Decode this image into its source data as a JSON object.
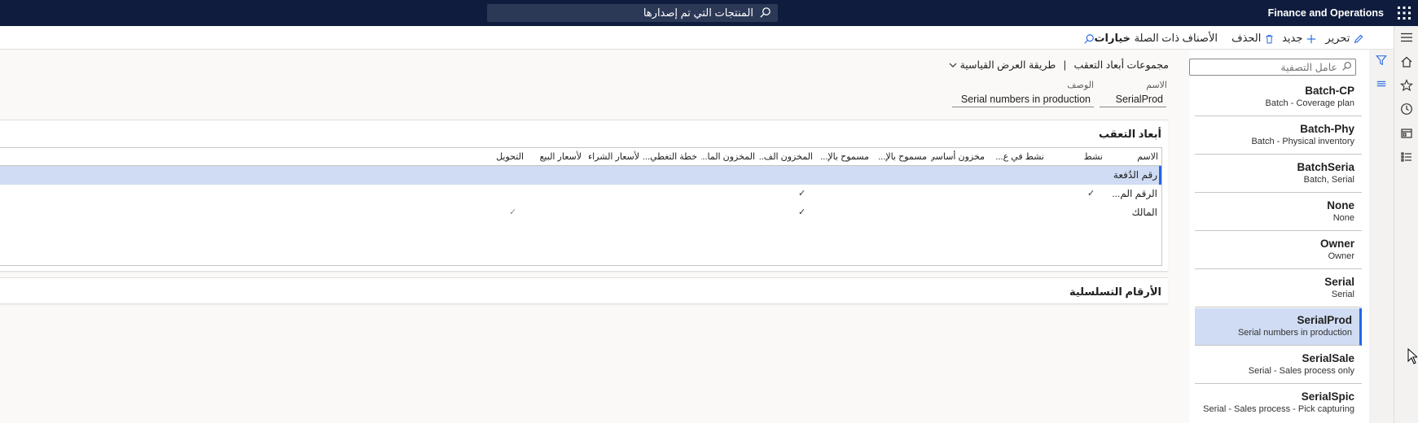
{
  "topbar": {
    "search_text": "المنتجات التي تم إصدارها",
    "app_title": "Finance and Operations"
  },
  "actions": {
    "edit": "تحرير",
    "new": "جديد",
    "delete": "الحذف",
    "related": "الأصناف ذات الصلة",
    "options": "خيارات"
  },
  "filter": {
    "placeholder": "عامل التصفية"
  },
  "list": [
    {
      "name": "Batch-CP",
      "desc": "Batch - Coverage plan"
    },
    {
      "name": "Batch-Phy",
      "desc": "Batch - Physical inventory"
    },
    {
      "name": "BatchSeria",
      "desc": "Batch, Serial"
    },
    {
      "name": "None",
      "desc": "None"
    },
    {
      "name": "Owner",
      "desc": "Owner"
    },
    {
      "name": "Serial",
      "desc": "Serial"
    },
    {
      "name": "SerialProd",
      "desc": "Serial numbers in production"
    },
    {
      "name": "SerialSale",
      "desc": "Serial - Sales process only"
    },
    {
      "name": "SerialSpic",
      "desc": "Serial - Sales process - Pick capturing"
    }
  ],
  "details": {
    "breadcrumb": "مجموعات أبعاد التعقب",
    "separator": "|",
    "view": "طريقة العرض القياسية",
    "name_label": "الاسم",
    "name_value": "SerialProd",
    "desc_label": "الوصف",
    "desc_value": "Serial numbers in production",
    "section1": "أبعاد التعقب",
    "section2": "الأرقام التسلسلية"
  },
  "grid": {
    "headers": [
      "الاسم",
      "نشط",
      "نشط في ع...",
      "مخزون أساسي",
      "مسموح بالإ...",
      "مسموح بالإ...",
      "المخزون الف...",
      "المخزون الما...",
      "خطة التغطي...",
      "لأسعار الشراء",
      "لأسعار البيع",
      "التحويل"
    ],
    "rows": [
      {
        "name": "رقم الدُفعة",
        "checks": []
      },
      {
        "name": "الرقم الم...",
        "checks": [
          "active",
          "physical"
        ]
      },
      {
        "name": "المالك",
        "checks": [
          "physical",
          "transfer"
        ]
      }
    ],
    "check_glyph": "✓"
  },
  "colors": {
    "topbar": "#0f1c3d",
    "selection": "#cfdcf3",
    "accent": "#2266e3"
  }
}
